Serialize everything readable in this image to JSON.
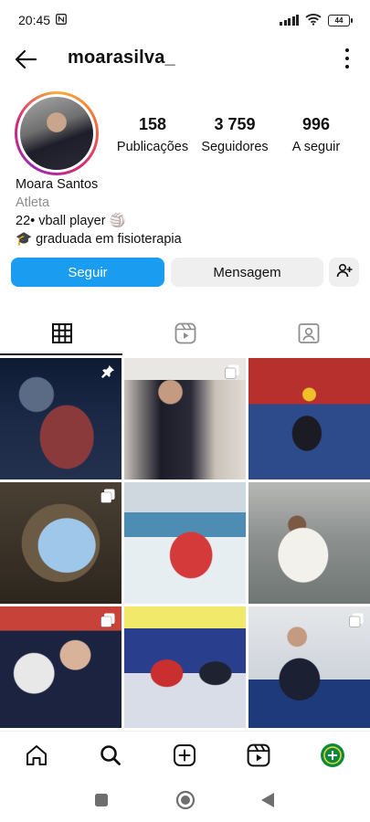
{
  "status_bar": {
    "time": "20:45",
    "battery": "44"
  },
  "header": {
    "username": "moarasilva_"
  },
  "profile": {
    "stats": [
      {
        "value": "158",
        "label": "Publicações"
      },
      {
        "value": "3 759",
        "label": "Seguidores"
      },
      {
        "value": "996",
        "label": "A seguir"
      }
    ],
    "name": "Moara Santos",
    "category": "Atleta",
    "bio_lines": [
      "22• vball player 🏐",
      "🎓 graduada em fisioterapia"
    ]
  },
  "actions": {
    "follow_label": "Seguir",
    "message_label": "Mensagem"
  },
  "colors": {
    "follow_button": "#1a9cf1",
    "secondary_button": "#efefef"
  },
  "tabs": [
    "grid-icon",
    "reels-icon",
    "tagged-icon"
  ],
  "posts": [
    {
      "badge": "pin-icon"
    },
    {
      "badge": "carousel-icon"
    },
    {
      "badge": ""
    },
    {
      "badge": "carousel-icon"
    },
    {
      "badge": ""
    },
    {
      "badge": ""
    },
    {
      "badge": "carousel-icon"
    },
    {
      "badge": ""
    },
    {
      "badge": "carousel-icon"
    }
  ]
}
